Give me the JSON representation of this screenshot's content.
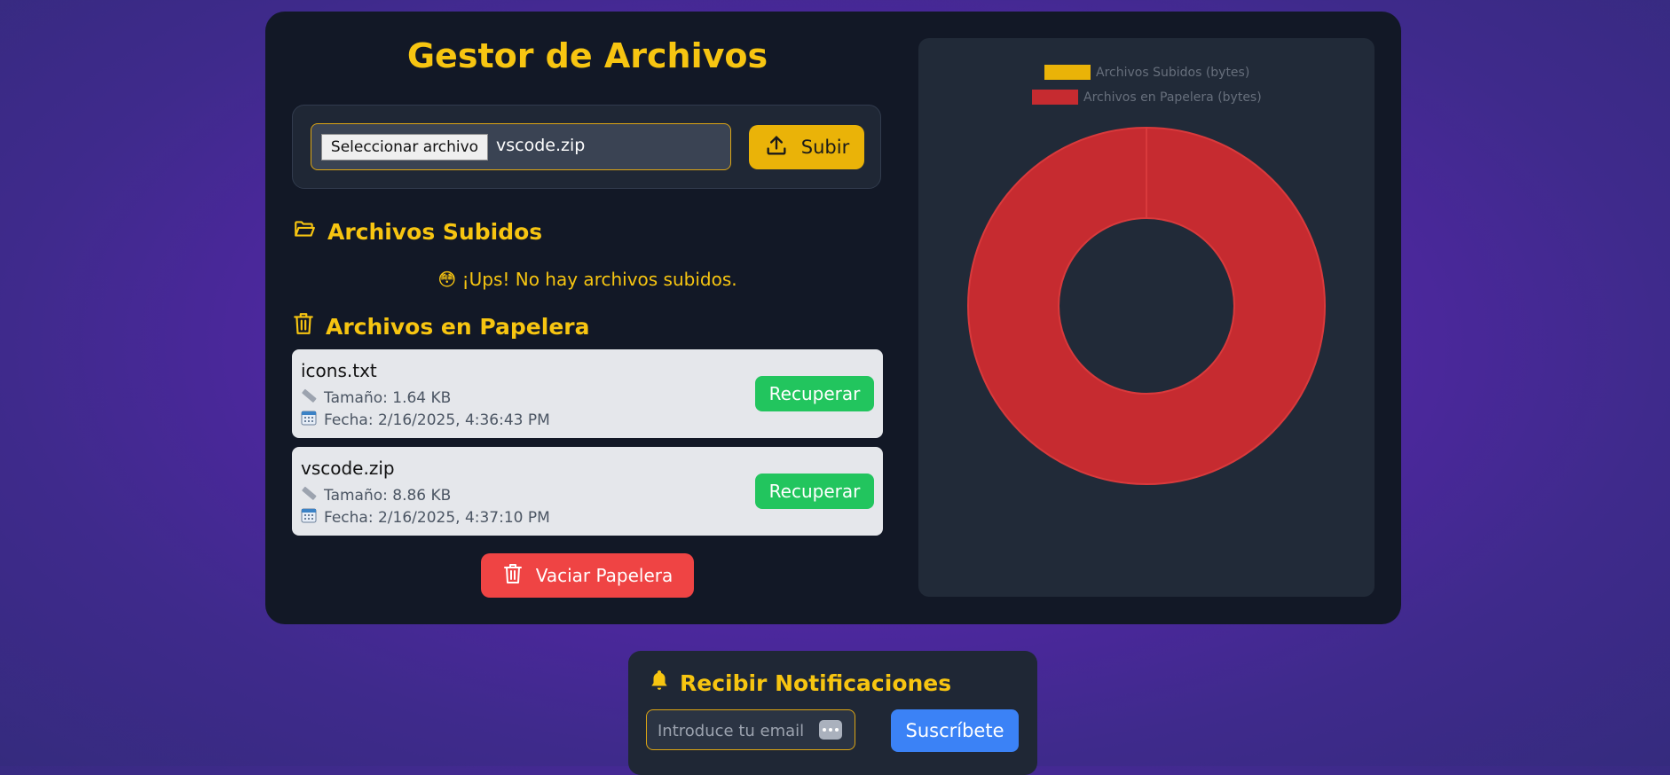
{
  "app": {
    "title": "Gestor de Archivos",
    "upload": {
      "choose_label": "Seleccionar archivo",
      "selected_file": "vscode.zip",
      "submit_label": "Subir"
    },
    "uploaded_section": {
      "heading": "Archivos Subidos",
      "empty_emoji": "😳",
      "empty_message": "¡Ups! No hay archivos subidos."
    },
    "trash_section": {
      "heading": "Archivos en Papelera",
      "items": [
        {
          "name": "icons.txt",
          "size": "Tamaño: 1.64 KB",
          "date": "Fecha: 2/16/2025, 4:36:43 PM",
          "action": "Recuperar"
        },
        {
          "name": "vscode.zip",
          "size": "Tamaño: 8.86 KB",
          "date": "Fecha: 2/16/2025, 4:37:10 PM",
          "action": "Recuperar"
        }
      ],
      "empty_trash_label": "Vaciar Papelera"
    }
  },
  "chart_data": {
    "type": "doughnut",
    "legend_position": "top",
    "series": [
      {
        "name": "Archivos Subidos (bytes)",
        "value": 0,
        "color": "#eab308"
      },
      {
        "name": "Archivos en Papelera (bytes)",
        "value": 10752,
        "color": "#c62b30"
      }
    ]
  },
  "notifications": {
    "heading": "Recibir Notificaciones",
    "email_placeholder": "Introduce tu email",
    "subscribe_label": "Suscríbete"
  },
  "colors": {
    "accent": "#f7c511",
    "primary_button": "#eab308",
    "success": "#22c55e",
    "danger": "#ef4444",
    "info": "#3b82f6"
  }
}
